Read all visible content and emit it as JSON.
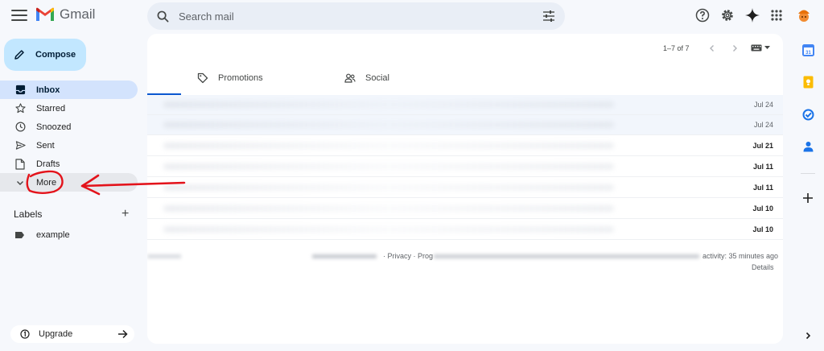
{
  "header": {
    "app_name": "Gmail",
    "search_placeholder": "Search mail"
  },
  "compose": {
    "label": "Compose"
  },
  "sidebar": {
    "items": [
      {
        "label": "Inbox",
        "icon": "inbox-icon",
        "active": true
      },
      {
        "label": "Starred",
        "icon": "star-icon"
      },
      {
        "label": "Snoozed",
        "icon": "clock-icon"
      },
      {
        "label": "Sent",
        "icon": "send-icon"
      },
      {
        "label": "Drafts",
        "icon": "draft-icon"
      },
      {
        "label": "More",
        "icon": "chevron-down-icon"
      }
    ],
    "labels_title": "Labels",
    "labels_add": "+",
    "labels": [
      {
        "name": "example"
      }
    ],
    "upgrade_label": "Upgrade"
  },
  "toolbar": {
    "pager": "1–7 of 7"
  },
  "tabs": [
    {
      "label": "Promotions",
      "icon": "tag-icon"
    },
    {
      "label": "Social",
      "icon": "people-icon"
    }
  ],
  "emails": [
    {
      "date": "Jul 24",
      "unread": false
    },
    {
      "date": "Jul 24",
      "unread": false
    },
    {
      "date": "Jul 21",
      "unread": true
    },
    {
      "date": "Jul 11",
      "unread": true
    },
    {
      "date": "Jul 11",
      "unread": true
    },
    {
      "date": "Jul 10",
      "unread": true
    },
    {
      "date": "Jul 10",
      "unread": true
    }
  ],
  "footer": {
    "links": "· Privacy · Prog",
    "activity": "activity: 35 minutes ago",
    "details": "Details"
  },
  "colors": {
    "accent": "#0b57d0",
    "compose_bg": "#c2e7ff",
    "active_nav": "#d3e3fd",
    "annotation": "#e3131b"
  }
}
